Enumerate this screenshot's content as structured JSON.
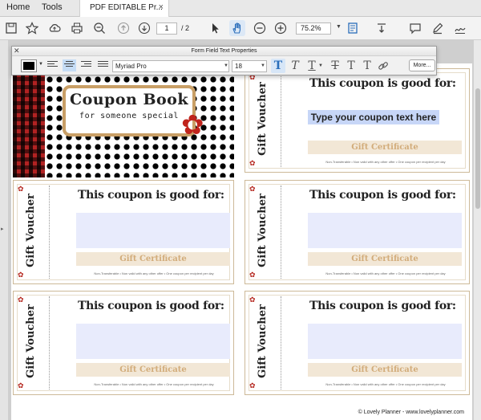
{
  "tabs": {
    "home": "Home",
    "tools": "Tools",
    "document": "PDF EDITABLE Pr...",
    "close": "×"
  },
  "toolbar": {
    "page_current": "1",
    "page_total": "/ 2",
    "zoom": "75.2%",
    "icons": [
      "save-icon",
      "bookmark-star-icon",
      "cloud-upload-icon",
      "print-icon",
      "zoom-out-search-icon",
      "prev-page-icon",
      "next-page-icon",
      "select-arrow-icon",
      "hand-icon",
      "zoom-minus-icon",
      "zoom-plus-icon",
      "zoom-dropdown-icon",
      "page-layout-icon",
      "scroll-mode-icon",
      "comment-icon",
      "pen-icon",
      "sign-icon"
    ]
  },
  "props": {
    "title": "Form Field Text Properties",
    "close": "✕",
    "font": "Myriad Pro",
    "size": "18",
    "more": "More...",
    "text_color": "#000000",
    "style_glyphs": [
      "T",
      "T",
      "T",
      "T",
      "T",
      "T"
    ]
  },
  "cover": {
    "title": "Coupon Book",
    "subtitle": "for someone special"
  },
  "coupon": {
    "headline": "This coupon is good for:",
    "vertical": "Gift Voucher",
    "gift": "Gift Certificate",
    "fine": "Non-Transferable • Non valid with any other offer • One coupon per recipient per day"
  },
  "active_field_text": "Type your coupon text here",
  "copyright": "© Lovely Planner - www.lovelyplanner.com"
}
